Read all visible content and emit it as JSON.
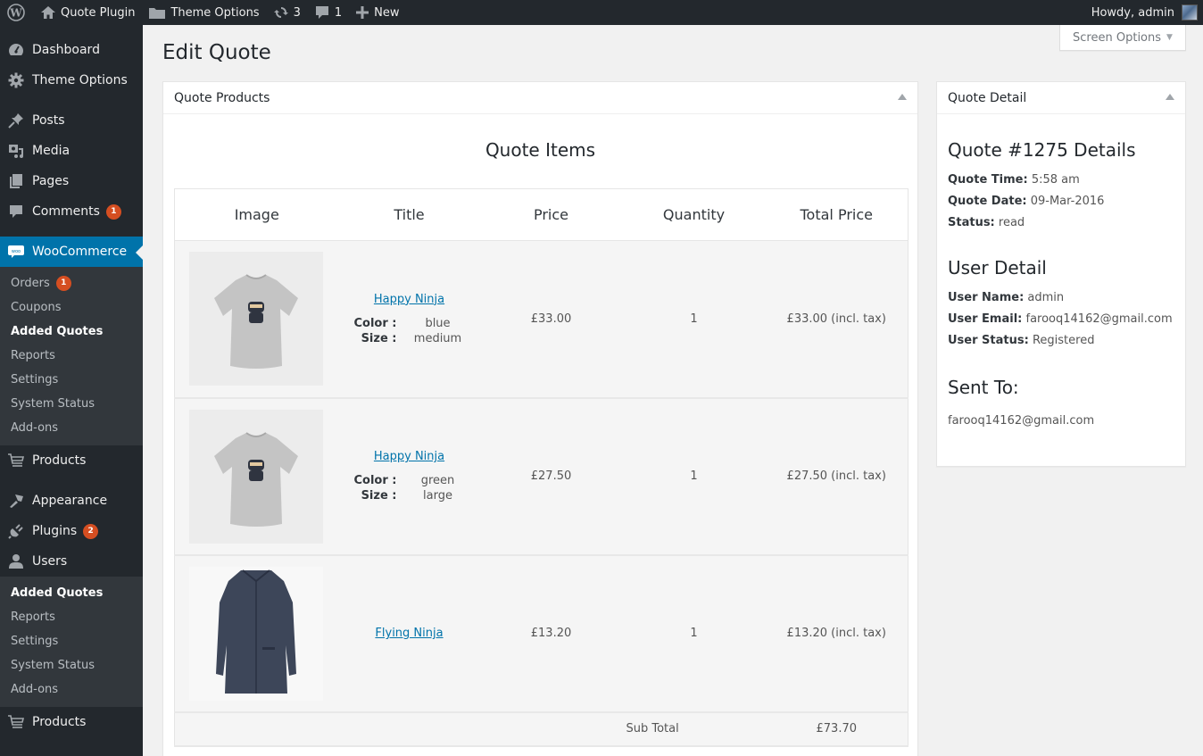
{
  "adminbar": {
    "items": [
      {
        "icon": "wordpress-logo-icon",
        "label": ""
      },
      {
        "icon": "home-icon",
        "label": "Quote Plugin"
      },
      {
        "icon": "folder-icon",
        "label": "Theme Options"
      },
      {
        "icon": "updates-icon",
        "label": "3"
      },
      {
        "icon": "comment-icon",
        "label": "1"
      },
      {
        "icon": "plus-icon",
        "label": "New"
      }
    ],
    "greeting": "Howdy, admin"
  },
  "sidebar": {
    "items": [
      {
        "label": "Dashboard",
        "icon": "dashboard-icon"
      },
      {
        "label": "Theme Options",
        "icon": "gear-icon"
      },
      {
        "label": "Posts",
        "icon": "pin-icon"
      },
      {
        "label": "Media",
        "icon": "media-icon"
      },
      {
        "label": "Pages",
        "icon": "pages-icon"
      },
      {
        "label": "Comments",
        "icon": "comment-icon",
        "badge": "1"
      },
      {
        "label": "WooCommerce",
        "icon": "woo-icon"
      },
      {
        "label": "Products",
        "icon": "cart-icon"
      },
      {
        "label": "Appearance",
        "icon": "brush-icon"
      },
      {
        "label": "Plugins",
        "icon": "plug-icon",
        "badge": "2"
      },
      {
        "label": "Users",
        "icon": "user-icon"
      },
      {
        "label": "Products",
        "icon": "cart-icon"
      }
    ],
    "woo_submenu": [
      {
        "label": "Orders",
        "badge": "1"
      },
      {
        "label": "Coupons"
      },
      {
        "label": "Added Quotes"
      },
      {
        "label": "Reports"
      },
      {
        "label": "Settings"
      },
      {
        "label": "System Status"
      },
      {
        "label": "Add-ons"
      }
    ],
    "users_submenu": [
      {
        "label": "Added Quotes"
      },
      {
        "label": "Reports"
      },
      {
        "label": "Settings"
      },
      {
        "label": "System Status"
      },
      {
        "label": "Add-ons"
      }
    ]
  },
  "screen_options": "Screen Options",
  "page_title": "Edit Quote",
  "products_box": {
    "title": "Quote Products",
    "items_title": "Quote Items",
    "columns": [
      "Image",
      "Title",
      "Price",
      "Quantity",
      "Total Price"
    ],
    "rows": [
      {
        "title": "Happy Ninja",
        "attrs": [
          {
            "k": "Color :",
            "v": "blue"
          },
          {
            "k": "Size :",
            "v": "medium"
          }
        ],
        "price": "£33.00",
        "qty": "1",
        "total": "£33.00 (incl. tax)",
        "image": "t-shirt"
      },
      {
        "title": "Happy Ninja",
        "attrs": [
          {
            "k": "Color :",
            "v": "green"
          },
          {
            "k": "Size :",
            "v": "large"
          }
        ],
        "price": "£27.50",
        "qty": "1",
        "total": "£27.50 (incl. tax)",
        "image": "t-shirt"
      },
      {
        "title": "Flying Ninja",
        "attrs": [],
        "price": "£13.20",
        "qty": "1",
        "total": "£13.20 (incl. tax)",
        "image": "coat"
      }
    ],
    "subtotal_label": "Sub Total",
    "subtotal_value": "£73.70"
  },
  "detail_box": {
    "title": "Quote Detail",
    "quote_heading": "Quote #1275 Details",
    "quote_time_label": "Quote Time:",
    "quote_time": "5:58 am",
    "quote_date_label": "Quote Date:",
    "quote_date": "09-Mar-2016",
    "status_label": "Status:",
    "status": "read",
    "user_heading": "User Detail",
    "user_name_label": "User Name:",
    "user_name": "admin",
    "user_email_label": "User Email:",
    "user_email": "farooq14162@gmail.com",
    "user_status_label": "User Status:",
    "user_status": "Registered",
    "sent_heading": "Sent To:",
    "sent_to": "farooq14162@gmail.com"
  },
  "colors": {
    "accent": "#0073aa",
    "badge": "#d54e21",
    "sidebar_bg": "#23282d",
    "submenu_bg": "#32373c"
  }
}
